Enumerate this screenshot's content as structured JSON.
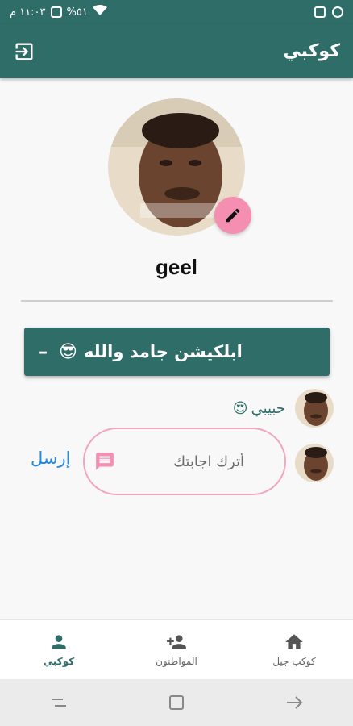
{
  "status_bar": {
    "time": "١١:٠٣ م",
    "battery": "%٥١"
  },
  "app_bar": {
    "title": "كوكبي"
  },
  "profile": {
    "username": "geel"
  },
  "post": {
    "text": "ابلكيشن جامد والله",
    "emoji": "😎",
    "collapse_icon": "–"
  },
  "comment": {
    "text": "حبيبي",
    "emoji": "😍"
  },
  "reply": {
    "placeholder": "أترك اجابتك",
    "send_label": "إرسل"
  },
  "bottom_nav": {
    "items": [
      {
        "label": "كوكب جيل",
        "icon": "home-icon"
      },
      {
        "label": "المواطنون",
        "icon": "person-add-icon"
      },
      {
        "label": "كوكبي",
        "icon": "person-icon"
      }
    ]
  },
  "colors": {
    "primary": "#2f6d68",
    "accent": "#f48fb1",
    "link": "#1e88e5"
  }
}
